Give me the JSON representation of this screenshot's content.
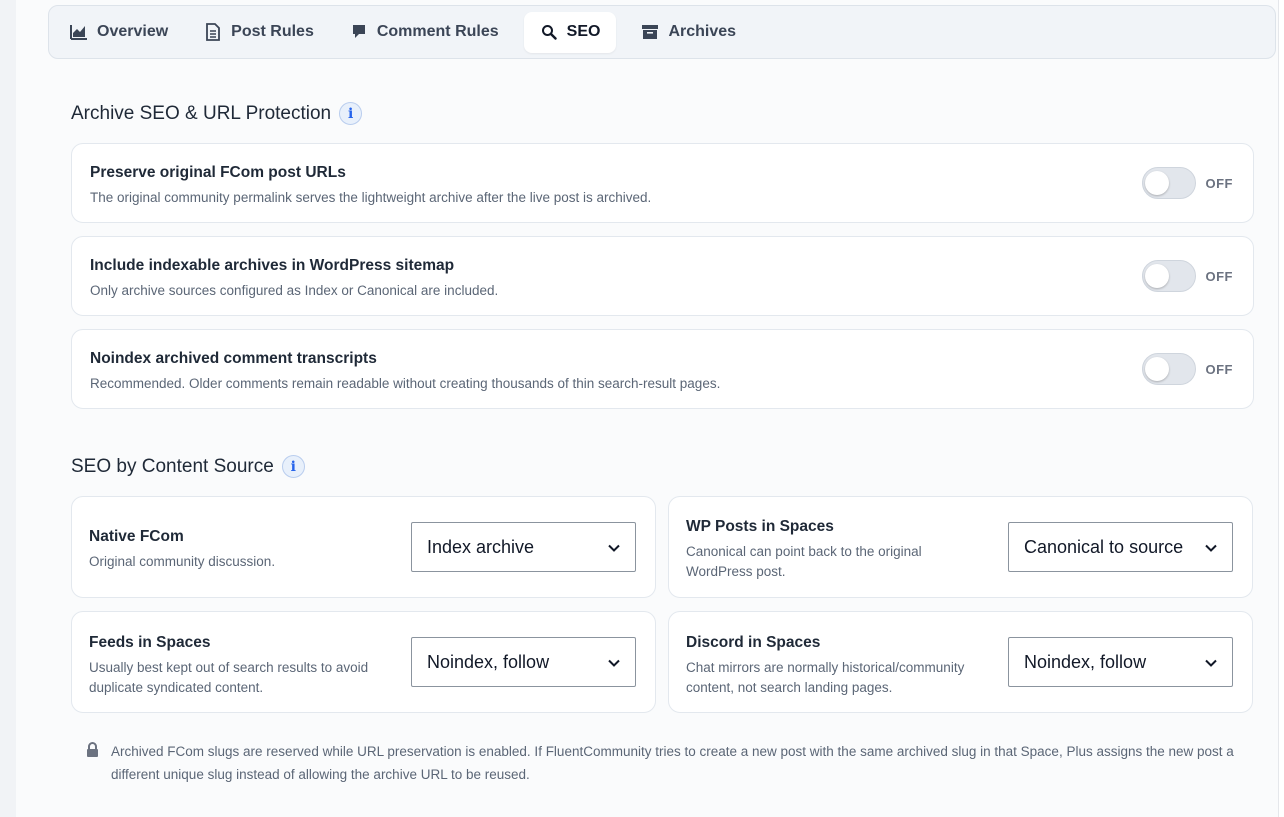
{
  "tabs": [
    {
      "label": "Overview",
      "icon": "chart-icon",
      "active": false
    },
    {
      "label": "Post Rules",
      "icon": "document-icon",
      "active": false
    },
    {
      "label": "Comment Rules",
      "icon": "comment-icon",
      "active": false
    },
    {
      "label": "SEO",
      "icon": "search-icon",
      "active": true
    },
    {
      "label": "Archives",
      "icon": "archive-box-icon",
      "active": false
    }
  ],
  "archive_section": {
    "title": "Archive SEO & URL Protection",
    "settings": [
      {
        "title": "Preserve original FCom post URLs",
        "description": "The original community permalink serves the lightweight archive after the live post is archived.",
        "state": "OFF"
      },
      {
        "title": "Include indexable archives in WordPress sitemap",
        "description": "Only archive sources configured as Index or Canonical are included.",
        "state": "OFF"
      },
      {
        "title": "Noindex archived comment transcripts",
        "description": "Recommended. Older comments remain readable without creating thousands of thin search-result pages.",
        "state": "OFF"
      }
    ]
  },
  "source_section": {
    "title": "SEO by Content Source",
    "sources": [
      {
        "title": "Native FCom",
        "description": "Original community discussion.",
        "selected": "Index archive"
      },
      {
        "title": "WP Posts in Spaces",
        "description": "Canonical can point back to the original WordPress post.",
        "selected": "Canonical to source"
      },
      {
        "title": "Feeds in Spaces",
        "description": "Usually best kept out of search results to avoid duplicate syndicated content.",
        "selected": "Noindex, follow"
      },
      {
        "title": "Discord in Spaces",
        "description": "Chat mirrors are normally historical/community content, not search landing pages.",
        "selected": "Noindex, follow"
      }
    ]
  },
  "note": "Archived FCom slugs are reserved while URL preservation is enabled. If FluentCommunity tries to create a new post with the same archived slug in that Space, Plus assigns the new post a different unique slug instead of allowing the archive URL to be reused.",
  "colors": {
    "accent": "#2563eb",
    "toggle_off": "#e2e6ec",
    "text": "#1f2937",
    "muted": "#5b6676"
  }
}
